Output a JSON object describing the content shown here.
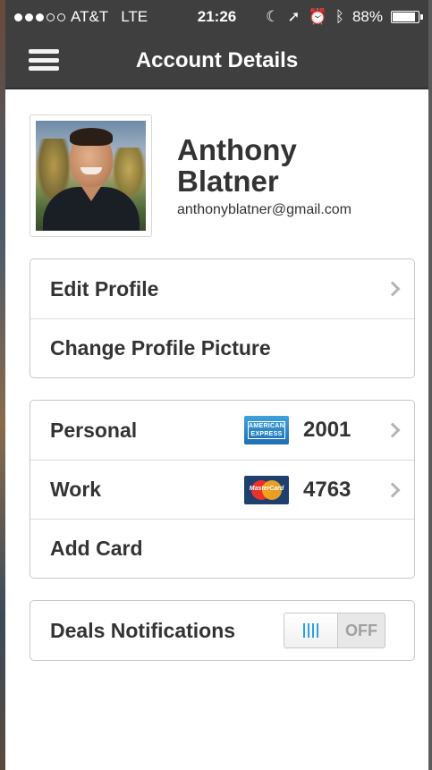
{
  "status_bar": {
    "carrier": "AT&T",
    "network": "LTE",
    "time": "21:26",
    "battery_percent": "88%",
    "battery_level": 0.88,
    "signal_bars_filled": 3,
    "signal_bars_total": 5
  },
  "nav": {
    "title": "Account Details"
  },
  "profile": {
    "first_name": "Anthony",
    "last_name": "Blatner",
    "email": "anthonyblatner@gmail.com"
  },
  "profile_actions": [
    {
      "label": "Edit Profile"
    },
    {
      "label": "Change Profile Picture"
    }
  ],
  "cards": [
    {
      "label": "Personal",
      "brand": "AMERICAN EXPRESS",
      "brand_line1": "AMERICAN",
      "brand_line2": "EXPRESS",
      "number": "2001"
    },
    {
      "label": "Work",
      "brand": "MasterCard",
      "number": "4763"
    },
    {
      "label": "Add Card"
    }
  ],
  "deals": {
    "label": "Deals Notifications",
    "toggle_off_label": "OFF",
    "enabled": false
  },
  "colors": {
    "nav_bg": "#3f3f3f",
    "text": "#333333",
    "toggle_accent": "#2aa0e0"
  }
}
